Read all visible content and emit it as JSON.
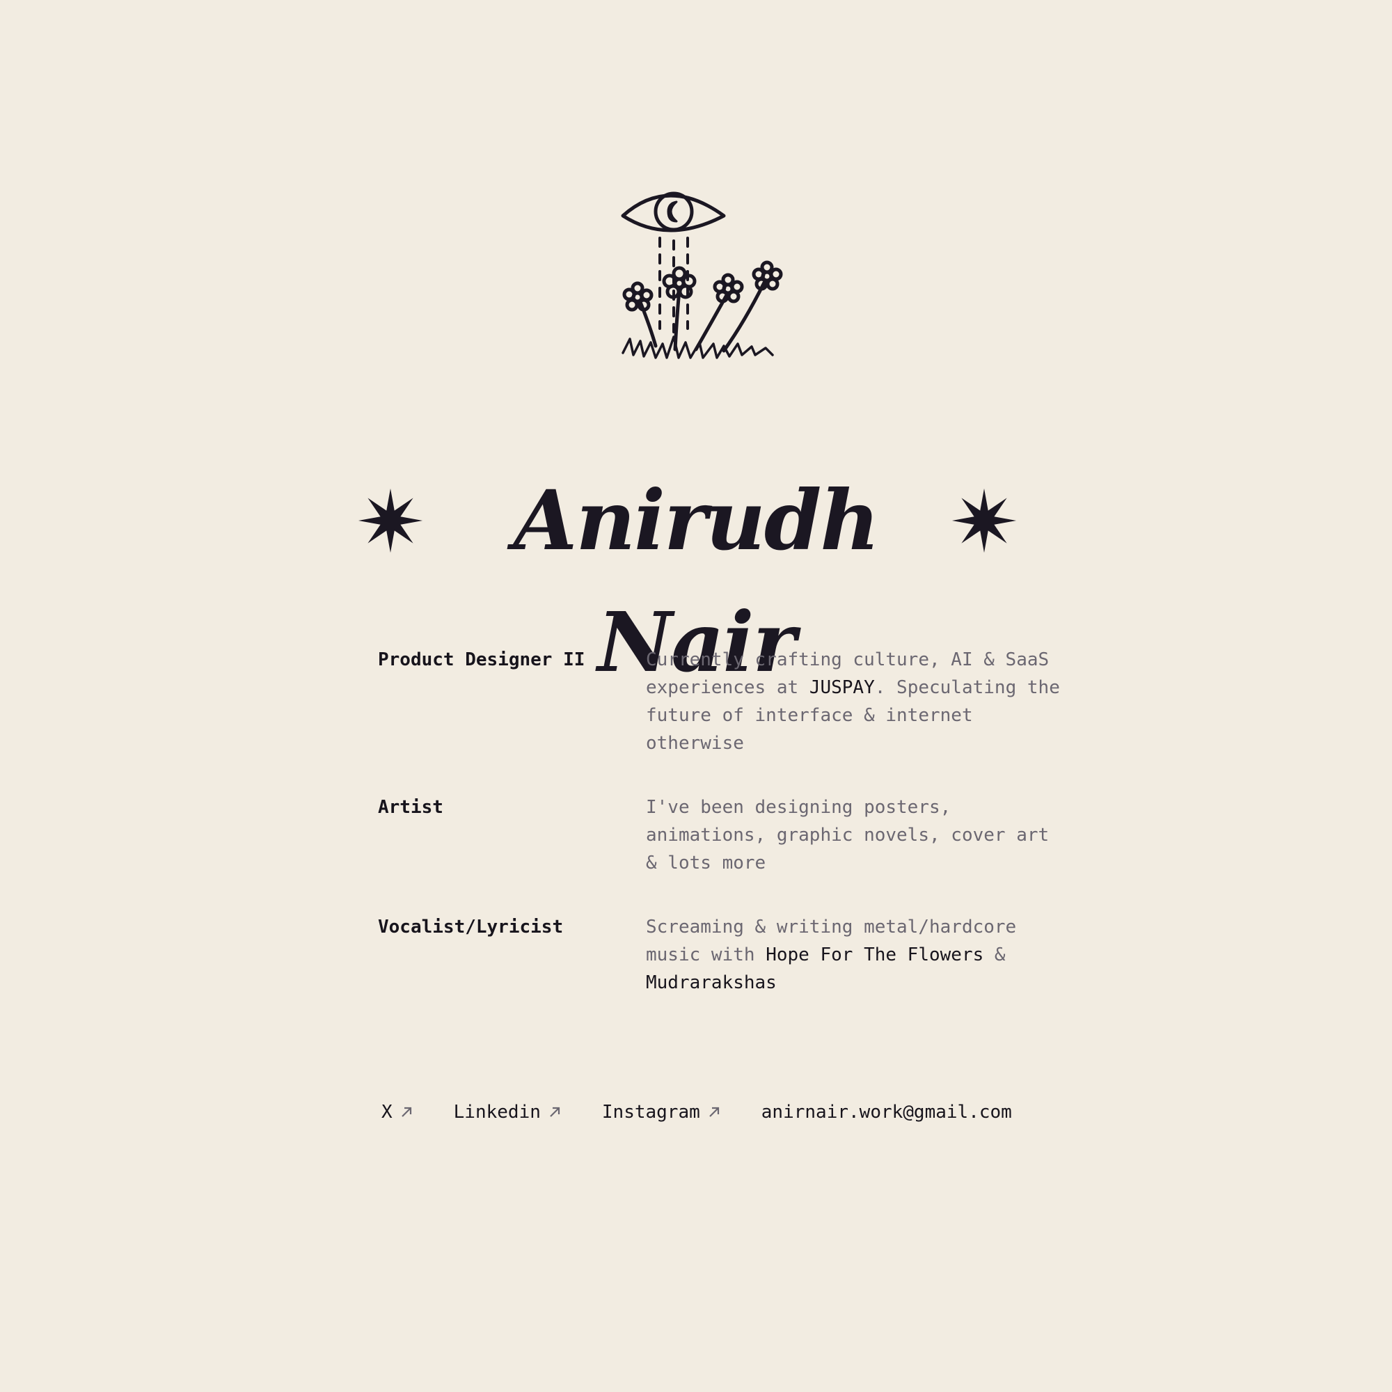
{
  "header": {
    "name": "Anirudh Nair",
    "logo_icon": "eye-flowers-illustration",
    "star_icon": "eight-point-star-icon"
  },
  "roles": [
    {
      "title": "Product Designer II",
      "desc_pre": "Currently crafting culture, AI & SaaS experiences at ",
      "desc_link": "JUSPAY",
      "desc_post": ". Speculating the future of interface & internet otherwise"
    },
    {
      "title": "Artist",
      "desc": "I've been designing posters, animations, graphic novels, cover art & lots more"
    },
    {
      "title": "Vocalist/Lyricist",
      "desc_pre": "Screaming & writing metal/hardcore music with ",
      "desc_link1": "Hope For The Flowers",
      "desc_mid": " & ",
      "desc_link2": "Mudrarakshas"
    }
  ],
  "links": {
    "x": "X",
    "linkedin": "Linkedin",
    "instagram": "Instagram",
    "email": "anirnair.work@gmail.com",
    "arrow_icon": "arrow-up-right-icon"
  },
  "colors": {
    "background": "#f2ece1",
    "ink": "#1b1722",
    "muted": "#6b6771"
  }
}
